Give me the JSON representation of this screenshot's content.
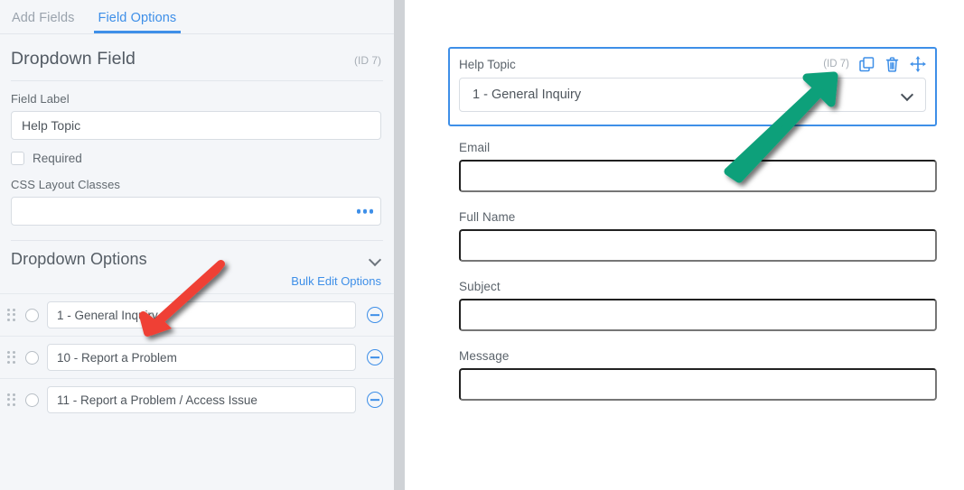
{
  "left_panel": {
    "tabs": [
      {
        "label": "Add Fields",
        "active": false
      },
      {
        "label": "Field Options",
        "active": true
      }
    ],
    "field_header": {
      "title": "Dropdown Field",
      "id_text": "(ID 7)"
    },
    "field_label": {
      "label": "Field Label",
      "value": "Help Topic"
    },
    "required": {
      "label": "Required",
      "checked": false
    },
    "css_layout_classes": {
      "label": "CSS Layout Classes",
      "value": "",
      "more_button": "•••"
    },
    "dropdown_options": {
      "section_title": "Dropdown Options",
      "bulk_edit_label": "Bulk Edit Options",
      "options": [
        {
          "value": "1 - General Inquiry",
          "selected": false
        },
        {
          "value": "10 - Report a Problem",
          "selected": false
        },
        {
          "value": "11 - Report a Problem / Access Issue",
          "selected": false
        }
      ]
    }
  },
  "right_panel": {
    "selected_field": {
      "label": "Help Topic",
      "id_text": "(ID 7)",
      "selected_value": "1 - General Inquiry",
      "icons": [
        "duplicate-icon",
        "trash-icon",
        "move-icon"
      ]
    },
    "fields": [
      {
        "label": "Email",
        "value": ""
      },
      {
        "label": "Full Name",
        "value": ""
      },
      {
        "label": "Subject",
        "value": ""
      },
      {
        "label": "Message",
        "value": ""
      }
    ]
  },
  "annotations": [
    {
      "name": "red-arrow",
      "color": "#ef4136",
      "direction": "down-left"
    },
    {
      "name": "teal-arrow",
      "color": "#11a07a",
      "direction": "up-right"
    }
  ],
  "colors": {
    "accent_blue": "#3e8fe8",
    "panel_bg": "#f4f6f9",
    "red_arrow": "#ef4136",
    "teal_arrow": "#11a07a"
  }
}
